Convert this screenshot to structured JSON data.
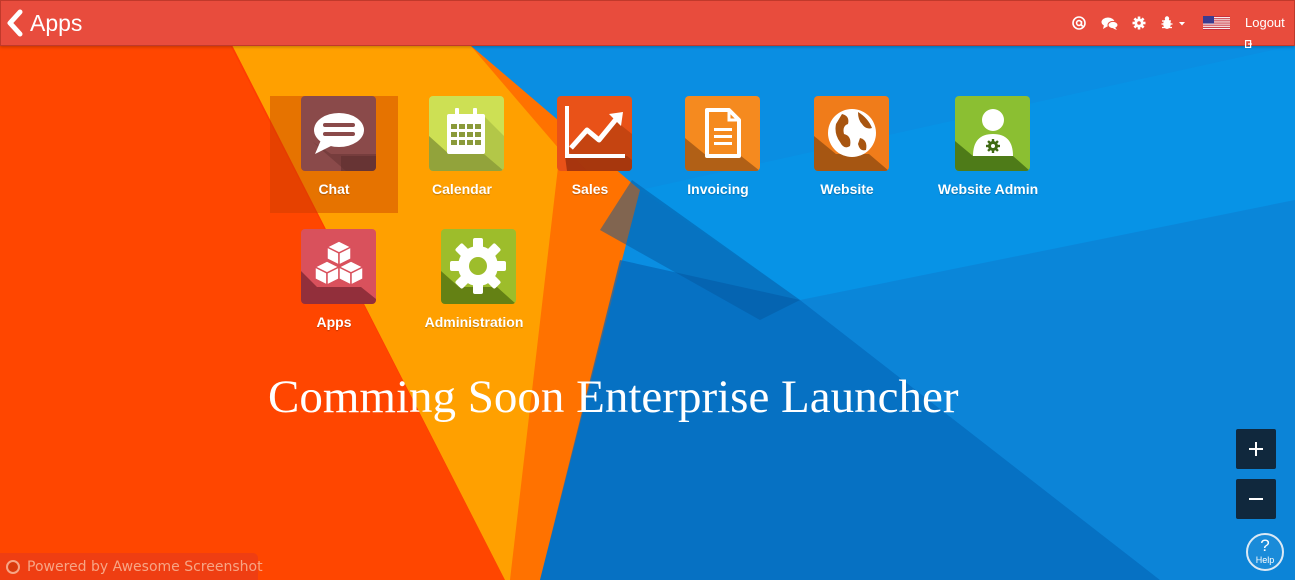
{
  "header": {
    "title": "Apps",
    "back_icon": "chevron-left-icon",
    "logout_label": "Logout",
    "icons": [
      "at-mention-icon",
      "chat-bubbles-icon",
      "gear-icon",
      "debug-bug-icon",
      "us-flag-icon"
    ]
  },
  "apps": [
    {
      "label": "Chat",
      "icon": "chat-bubble-icon",
      "color": "#8a4a4a",
      "selected": true
    },
    {
      "label": "Calendar",
      "icon": "calendar-icon",
      "color": "#cde054"
    },
    {
      "label": "Sales",
      "icon": "trend-chart-icon",
      "color": "#e95218"
    },
    {
      "label": "Invoicing",
      "icon": "document-icon",
      "color": "#f58a1f"
    },
    {
      "label": "Website",
      "icon": "globe-icon",
      "color": "#f07c1a"
    },
    {
      "label": "Website Admin",
      "icon": "user-settings-icon",
      "color": "#8bbf32"
    },
    {
      "label": "Apps",
      "icon": "cubes-icon",
      "color": "#d9515c"
    },
    {
      "label": "Administration",
      "icon": "gear-icon",
      "color": "#9dbd2b"
    }
  ],
  "banner": {
    "text": "Comming Soon Enterprise Launcher"
  },
  "zoom": {
    "in_label": "+",
    "out_label": "−"
  },
  "help": {
    "symbol": "?",
    "label": "Help"
  },
  "footer": {
    "powered_text": "Powered by Awesome Screenshot"
  },
  "colors": {
    "topbar": "#e84c3d",
    "bg_red": "#ff3d00",
    "bg_yellow": "#ffa000",
    "bg_blue": "#0288d1",
    "zoom_bg": "#10283d"
  }
}
